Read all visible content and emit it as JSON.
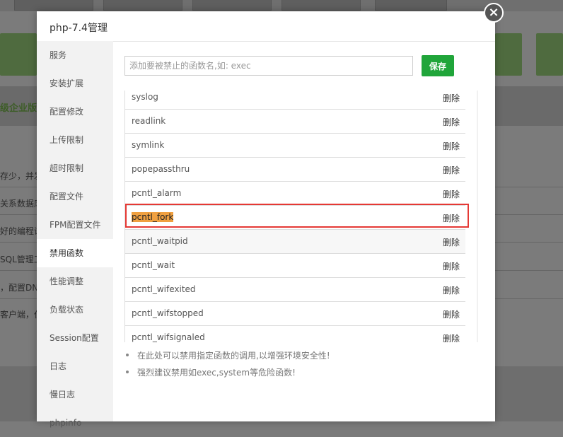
{
  "background": {
    "strip_text": "级企业版插",
    "rows": [
      "存少，并发",
      "关系数据库",
      "好的编程语",
      "SQL管理工",
      "，配置DNS",
      "客户端，仅"
    ]
  },
  "dialog": {
    "title": "php-7.4管理",
    "close_symbol": "×"
  },
  "sidebar": {
    "items": [
      {
        "label": "服务"
      },
      {
        "label": "安装扩展"
      },
      {
        "label": "配置修改"
      },
      {
        "label": "上传限制"
      },
      {
        "label": "超时限制"
      },
      {
        "label": "配置文件"
      },
      {
        "label": "FPM配置文件"
      },
      {
        "label": "禁用函数"
      },
      {
        "label": "性能调整"
      },
      {
        "label": "负载状态"
      },
      {
        "label": "Session配置"
      },
      {
        "label": "日志"
      },
      {
        "label": "慢日志"
      },
      {
        "label": "phpinfo"
      }
    ],
    "active_index": 7
  },
  "form": {
    "placeholder": "添加要被禁止的函数名,如: exec",
    "save_label": "保存"
  },
  "functions": {
    "delete_label": "删除",
    "items": [
      "syslog",
      "readlink",
      "symlink",
      "popepassthru",
      "pcntl_alarm",
      "pcntl_fork",
      "pcntl_waitpid",
      "pcntl_wait",
      "pcntl_wifexited",
      "pcntl_wifstopped",
      "pcntl_wifsignaled"
    ],
    "highlighted": "pcntl_fork",
    "hovered": "pcntl_waitpid"
  },
  "notes": [
    "在此处可以禁用指定函数的调用,以增强环境安全性!",
    "强烈建议禁用如exec,system等危险函数!"
  ],
  "colors": {
    "accent": "#20a53a",
    "highlight": "#f0a040",
    "outline": "#e53935"
  }
}
